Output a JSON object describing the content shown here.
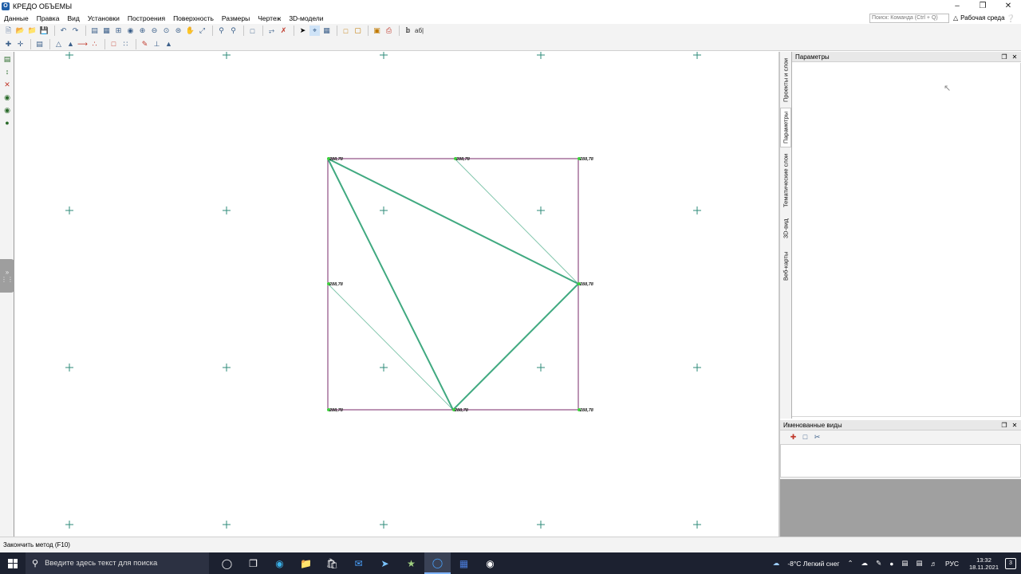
{
  "window": {
    "title": "КРЕДО ОБЪЕМЫ",
    "icon_letter": "O",
    "controls": [
      "minimize-icon",
      "restore-icon",
      "close-icon"
    ]
  },
  "menu": {
    "items": [
      "Данные",
      "Правка",
      "Вид",
      "Установки",
      "Построения",
      "Поверхность",
      "Размеры",
      "Чертеж",
      "3D-модели"
    ],
    "search_placeholder": "Поиск: Команда (Ctrl + Q)",
    "workspace_label": "Рабочая среда"
  },
  "toolbar": {
    "text_tool_label": "аб|"
  },
  "panels": {
    "vertical_tabs": [
      "Проекты и слои",
      "Параметры",
      "Тематические слои",
      "3D-вид",
      "Веб-карты"
    ],
    "active_tab": "Параметры",
    "parameters_title": "Параметры",
    "named_views_title": "Именованные виды"
  },
  "drawing": {
    "point_label": "288,78",
    "colors": {
      "grid_cross": "#2e8b7a",
      "boundary": "#7a2a6a",
      "triangle_edge": "#1f9a6a",
      "point_marker": "#3ecf3e"
    }
  },
  "status": {
    "text": "Закончить метод (F10)"
  },
  "taskbar": {
    "search_placeholder": "Введите здесь текст для поиска",
    "weather": "-8°C  Легкий снег",
    "language": "РУС",
    "time": "13:32",
    "date": "18.11.2021",
    "notifications": "3"
  }
}
